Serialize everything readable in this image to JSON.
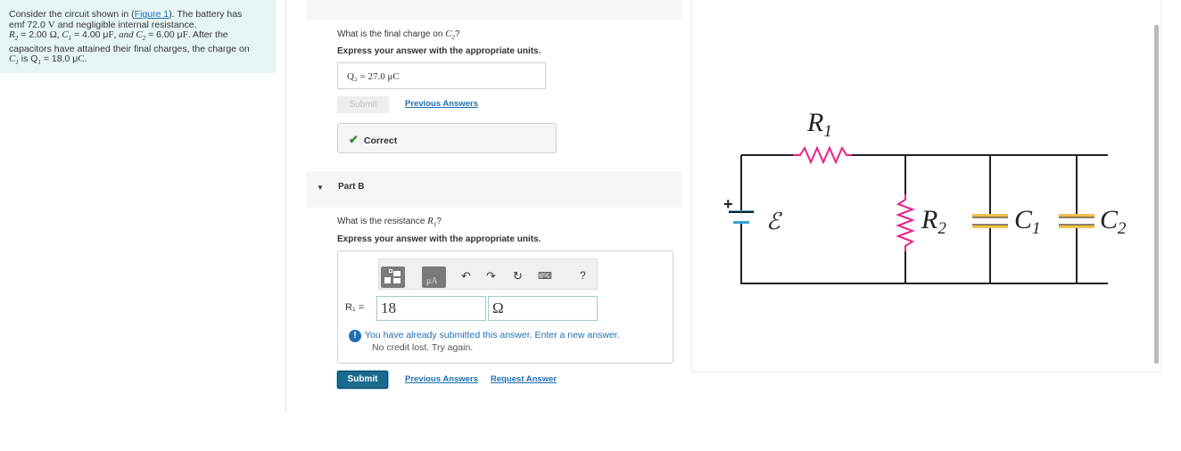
{
  "problem": {
    "intro": "Consider the circuit shown in (",
    "figure_link": "Figure 1",
    "intro_end": "). The battery has",
    "line2a": "emf 72.0 ",
    "line2_unit": "V",
    "line2b": " and negligible internal resistance.",
    "r2": "R",
    "r2_sub": "2",
    "r2_val": " = 2.00 ",
    "r2_unit": "Ω",
    "c1": ", C",
    "c1_sub": "1",
    "c1_val": " = 4.00 μ",
    "c1_unit": "F",
    "c2": ", and C",
    "c2_sub": "2",
    "c2_val": " = 6.00 μ",
    "c2_unit": "F",
    "line3_end": ". After the",
    "line4": "capacitors have attained their final charges, the charge on",
    "line5a": "C",
    "line5a_sub": "1",
    "line5b": " is Q",
    "line5b_sub": "1",
    "line5c": " = 18.0 μ",
    "line5_unit": "C",
    "line5_end": "."
  },
  "partA": {
    "question_pre": "What is the final charge on ",
    "question_var": "C",
    "question_sub": "2",
    "question_post": "?",
    "instruction": "Express your answer with the appropriate units.",
    "answer": "Q₂ =  27.0 μC",
    "submit_label": "Submit",
    "previous_answers": "Previous Answers",
    "feedback": "Correct"
  },
  "partB": {
    "label": "Part B",
    "question_pre": "What is the resistance ",
    "question_var": "R",
    "question_sub": "1",
    "question_post": "?",
    "instruction": "Express your answer with the appropriate units.",
    "var_label": "R₁ =",
    "value": "18",
    "unit": "Ω",
    "toolbar_mu": "μA",
    "toolbar_help": "?",
    "warning_line1": "You have already submitted this answer. Enter a new answer.",
    "warning_line2": "No credit lost. Try again.",
    "submit_label": "Submit",
    "previous_answers": "Previous Answers",
    "request_answer": "Request Answer"
  },
  "figure": {
    "r1": "R",
    "r1_sub": "1",
    "emf": "ℰ",
    "plus": "+",
    "r2": "R",
    "r2_sub": "2",
    "c1": "C",
    "c1_sub": "1",
    "c2": "C",
    "c2_sub": "2",
    "colors": {
      "resistor": "#e8208c",
      "plate": "#f2c14e",
      "wire": "#222222",
      "battery_plate": "#3aa0d8"
    }
  }
}
